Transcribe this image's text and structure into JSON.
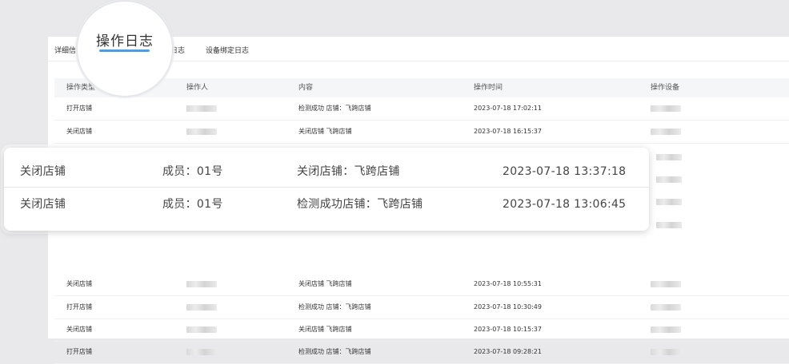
{
  "tabs": {
    "tab1": "详细信",
    "tab3": "日志",
    "tab4": "设备绑定日志"
  },
  "magnifier": {
    "active_tab": "操作日志"
  },
  "table": {
    "headers": [
      "操作类型",
      "操作人",
      "内容",
      "操作时间",
      "操作设备"
    ],
    "top_rows": [
      {
        "type": "打开店铺",
        "content": "检测成功 店铺：飞跨店铺",
        "time": "2023-07-18 17:02:11"
      },
      {
        "type": "关闭店铺",
        "content": "关闭店铺 飞跨店铺",
        "time": "2023-07-18 16:15:37"
      }
    ],
    "bottom_rows": [
      {
        "type": "关闭店铺",
        "content": "关闭店铺 飞跨店铺",
        "time": "2023-07-18 10:55:31"
      },
      {
        "type": "打开店铺",
        "content": "检测成功 店铺：飞跨店铺",
        "time": "2023-07-18 10:30:49"
      },
      {
        "type": "关闭店铺",
        "content": "关闭店铺 飞跨店铺",
        "time": "2023-07-18 10:15:37"
      },
      {
        "type": "打开店铺",
        "content": "检测成功 店铺：飞跨店铺",
        "time": "2023-07-18 09:28:21"
      }
    ]
  },
  "zoom": {
    "rows": [
      {
        "type": "关闭店铺",
        "operator": "成员：01号",
        "content": "关闭店铺：飞跨店铺",
        "time": "2023-07-18 13:37:18"
      },
      {
        "type": "关闭店铺",
        "operator": "成员：01号",
        "content": "检测成功店铺：飞跨店铺",
        "time": "2023-07-18 13:06:45"
      }
    ]
  }
}
